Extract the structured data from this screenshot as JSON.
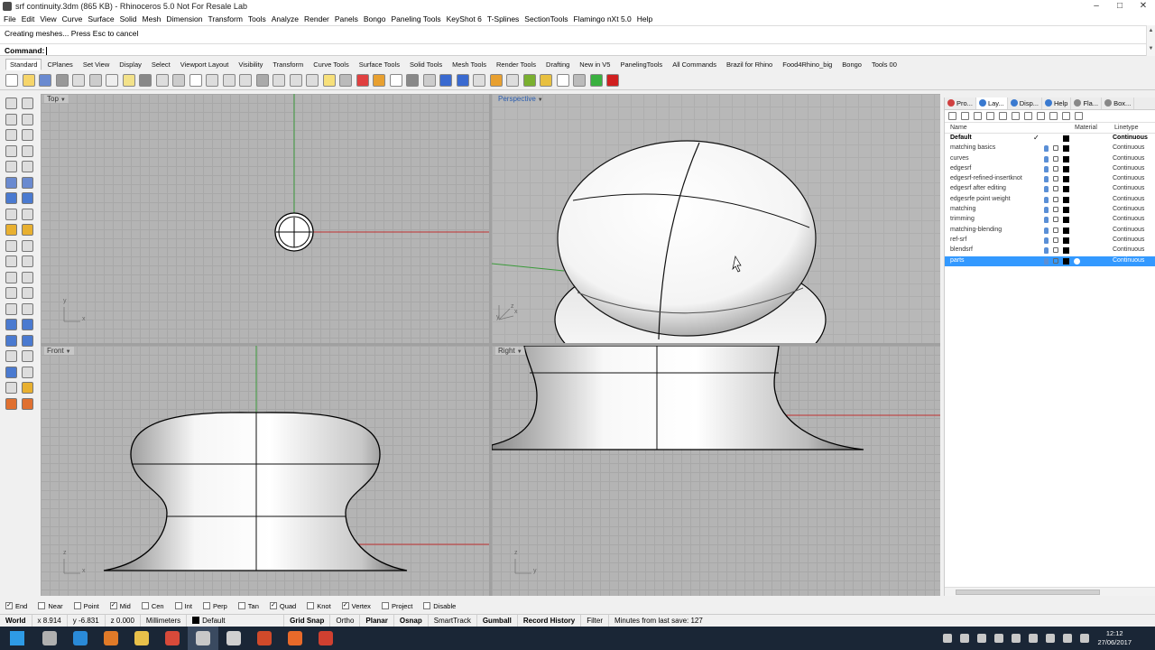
{
  "window": {
    "title": "srf continuity.3dm (865 KB) - Rhinoceros 5.0 Not For Resale Lab",
    "min": "–",
    "max": "□",
    "close": "✕"
  },
  "menu": [
    "File",
    "Edit",
    "View",
    "Curve",
    "Surface",
    "Solid",
    "Mesh",
    "Dimension",
    "Transform",
    "Tools",
    "Analyze",
    "Render",
    "Panels",
    "Bongo",
    "Paneling Tools",
    "KeyShot 6",
    "T-Splines",
    "SectionTools",
    "Flamingo nXt 5.0",
    "Help"
  ],
  "command_history": "Creating meshes... Press Esc to cancel",
  "command_prompt": "Command:",
  "toolbar_tabs": [
    "Standard",
    "CPlanes",
    "Set View",
    "Display",
    "Select",
    "Viewport Layout",
    "Visibility",
    "Transform",
    "Curve Tools",
    "Surface Tools",
    "Solid Tools",
    "Mesh Tools",
    "Render Tools",
    "Drafting",
    "New in V5",
    "PanelingTools",
    "All Commands",
    "Brazil for Rhino",
    "Food4Rhino_big",
    "Bongo",
    "Tools 00"
  ],
  "toolbar_icons": [
    "new-file-icon",
    "open-file-icon",
    "save-icon",
    "print-icon",
    "import-icon",
    "cut-icon",
    "copy-icon",
    "paste-icon",
    "undo-icon",
    "pan-icon",
    "rotate-view-icon",
    "zoom-icon",
    "zoom-window-icon",
    "zoom-extents-icon",
    "zoom-selected-icon",
    "four-viewports-icon",
    "grid-icon",
    "properties-icon",
    "select-icon",
    "lightbulb-icon",
    "lock-icon",
    "color-icon",
    "color-wheel-icon",
    "shaded-sphere-icon",
    "render-sphere-icon",
    "ghost-sphere-icon",
    "blue-sphere-icon",
    "help-icon",
    "arrow-icon",
    "brush-icon",
    "plugin-icon",
    "gear-icon",
    "clock-icon",
    "ring-icon",
    "cylinder-icon",
    "green-box-icon",
    "red-circle-icon"
  ],
  "viewports": {
    "top": {
      "label": "Top",
      "axis_a": "y",
      "axis_b": "x"
    },
    "perspective": {
      "label": "Perspective",
      "axis_a": "y",
      "axis_b": "x",
      "axis_c": "z"
    },
    "front": {
      "label": "Front",
      "axis_a": "z",
      "axis_b": "x"
    },
    "right": {
      "label": "Right",
      "axis_a": "z",
      "axis_b": "y"
    }
  },
  "panel": {
    "tabs": [
      {
        "label": "Pro...",
        "icon": "properties-icon",
        "color": "#d04040"
      },
      {
        "label": "Lay...",
        "icon": "layers-icon",
        "color": "#3a7ad0"
      },
      {
        "label": "Disp...",
        "icon": "display-icon",
        "color": "#3a7ad0"
      },
      {
        "label": "Help",
        "icon": "help-icon",
        "color": "#3a7ad0"
      },
      {
        "label": "Fla...",
        "icon": "flamingo-icon",
        "color": "#888888"
      },
      {
        "label": "Box...",
        "icon": "box-icon",
        "color": "#888888"
      }
    ],
    "column_name": "Name",
    "column_material": "Material",
    "column_linetype": "Linetype",
    "layers": [
      {
        "name": "Default",
        "linetype": "Continuous",
        "current": true,
        "check": "✓"
      },
      {
        "name": "matching basics",
        "linetype": "Continuous"
      },
      {
        "name": "curves",
        "linetype": "Continuous"
      },
      {
        "name": "edgesrf",
        "linetype": "Continuous"
      },
      {
        "name": "edgesrf-refined-insertknot",
        "linetype": "Continuous"
      },
      {
        "name": "edgesrf after editing",
        "linetype": "Continuous"
      },
      {
        "name": "edgesrfe point weight",
        "linetype": "Continuous"
      },
      {
        "name": "matching",
        "linetype": "Continuous"
      },
      {
        "name": "trimming",
        "linetype": "Continuous"
      },
      {
        "name": "matching-blending",
        "linetype": "Continuous"
      },
      {
        "name": "ref-srf",
        "linetype": "Continuous"
      },
      {
        "name": "blendsrf",
        "linetype": "Continuous"
      },
      {
        "name": "parts",
        "linetype": "Continuous",
        "selected": true
      }
    ]
  },
  "osnaps": [
    {
      "label": "End",
      "checked": true
    },
    {
      "label": "Near",
      "checked": false
    },
    {
      "label": "Point",
      "checked": false
    },
    {
      "label": "Mid",
      "checked": true
    },
    {
      "label": "Cen",
      "checked": false
    },
    {
      "label": "Int",
      "checked": false
    },
    {
      "label": "Perp",
      "checked": false
    },
    {
      "label": "Tan",
      "checked": false
    },
    {
      "label": "Quad",
      "checked": true
    },
    {
      "label": "Knot",
      "checked": false
    },
    {
      "label": "Vertex",
      "checked": true
    },
    {
      "label": "Project",
      "checked": false
    },
    {
      "label": "Disable",
      "checked": false
    }
  ],
  "status": {
    "cplane": "World",
    "x": "x 8.914",
    "y": "y -6.831",
    "z": "z 0.000",
    "units": "Millimeters",
    "layer": "Default",
    "grid_snap": "Grid Snap",
    "ortho": "Ortho",
    "planar": "Planar",
    "osnap": "Osnap",
    "smarttrack": "SmartTrack",
    "gumball": "Gumball",
    "record_history": "Record History",
    "filter": "Filter",
    "last_save": "Minutes from last save: 127"
  },
  "taskbar": {
    "apps": [
      {
        "icon": "windows-start-icon",
        "color": "#2e9be6"
      },
      {
        "icon": "app-icon",
        "color": "#b0b0b0"
      },
      {
        "icon": "internet-explorer-icon",
        "color": "#2a8ad8"
      },
      {
        "icon": "media-player-icon",
        "color": "#e07a28"
      },
      {
        "icon": "file-explorer-icon",
        "color": "#e8c04a"
      },
      {
        "icon": "chrome-icon",
        "color": "#d84a3a"
      },
      {
        "icon": "rhino-icon",
        "color": "#c8c8c8"
      },
      {
        "icon": "scan-icon",
        "color": "#d0d0d0"
      },
      {
        "icon": "ppt-icon",
        "color": "#d04a2a"
      },
      {
        "icon": "grasshopper-icon",
        "color": "#e86a2a"
      },
      {
        "icon": "recorder-icon",
        "color": "#d04030"
      }
    ],
    "tray": [
      "lightbulb-tray-icon",
      "network-tray-icon",
      "app-tray-icon",
      "cloud-tray-icon",
      "shield-tray-icon",
      "battery-tray-icon",
      "wifi-tray-icon",
      "flag-tray-icon",
      "volume-tray-icon"
    ],
    "time": "12:12",
    "date": "27/06/2017"
  }
}
